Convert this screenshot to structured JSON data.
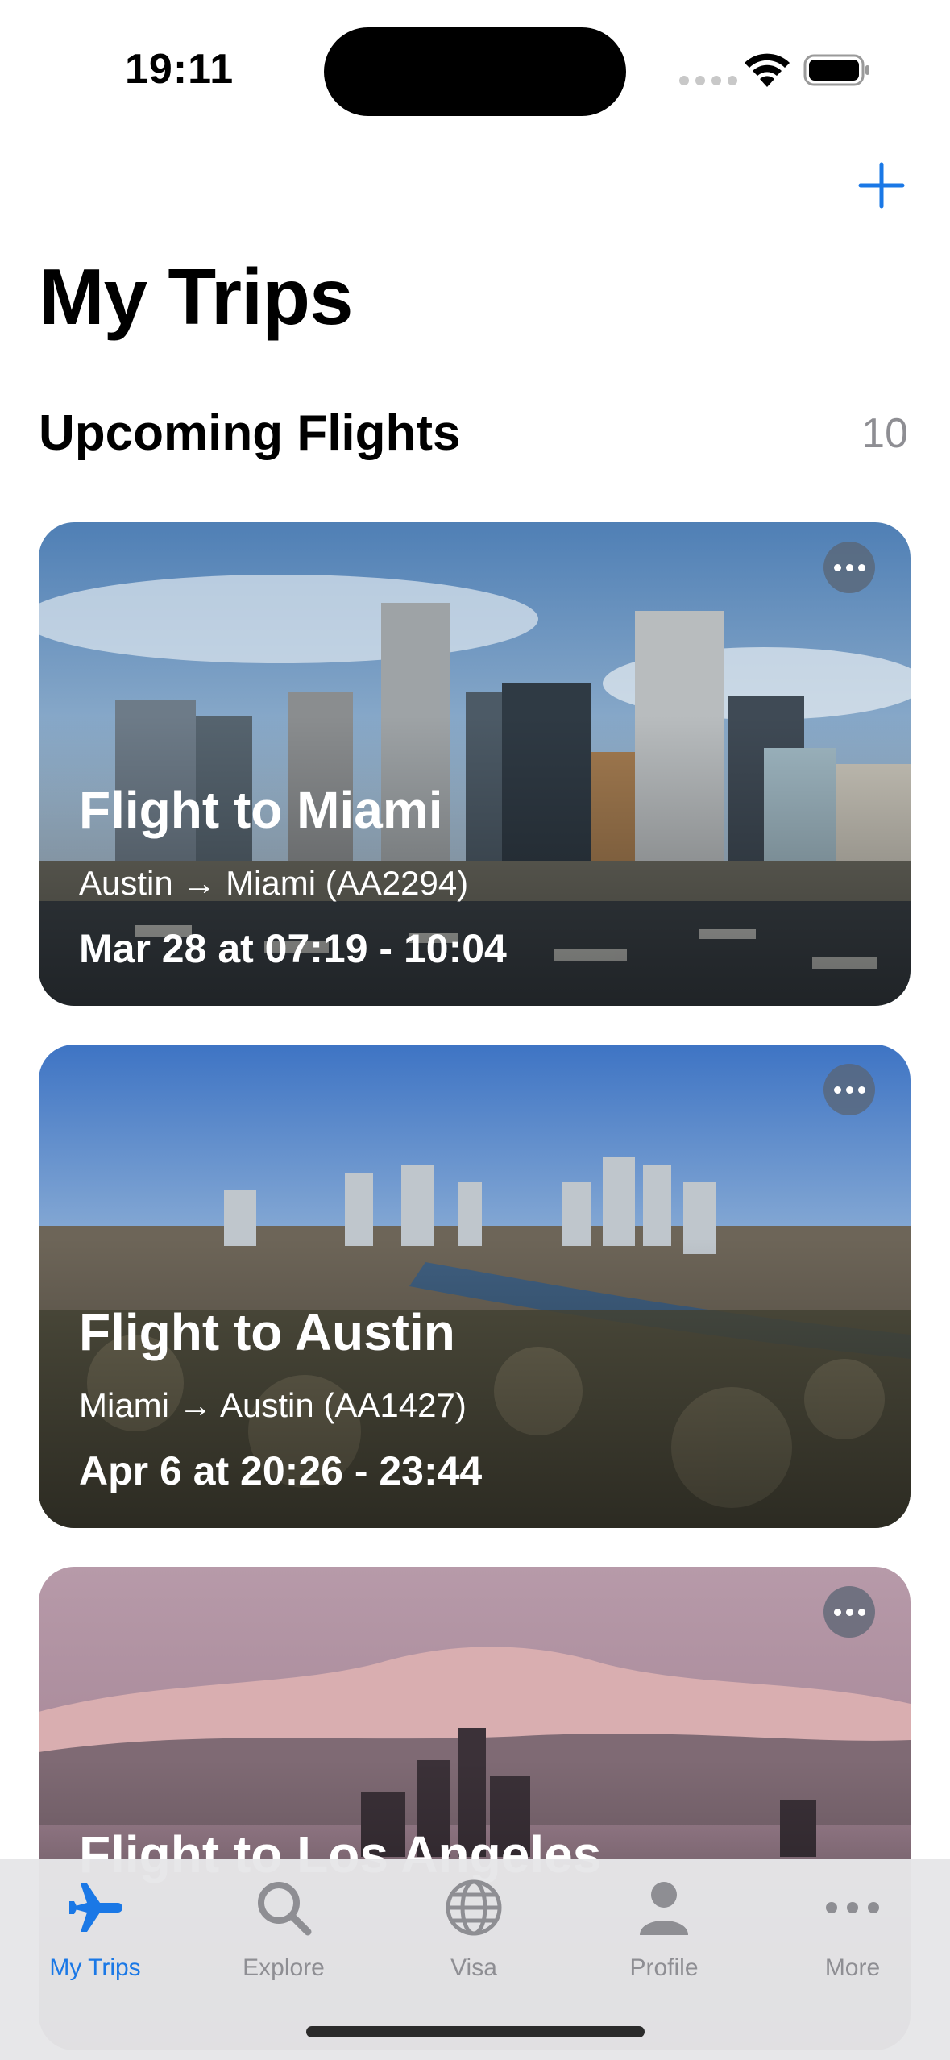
{
  "status_bar": {
    "time": "19:11"
  },
  "header": {
    "title": "My Trips"
  },
  "section": {
    "title": "Upcoming Flights",
    "count": "10"
  },
  "trips": [
    {
      "title": "Flight to Miami",
      "route": "Austin → Miami (AA2294)",
      "time": "Mar 28 at 07:19 - 10:04"
    },
    {
      "title": "Flight to Austin",
      "route": "Miami → Austin (AA1427)",
      "time": "Apr 6 at 20:26 - 23:44"
    },
    {
      "title": "Flight to Los Angeles"
    }
  ],
  "tabs": [
    {
      "label": "My Trips",
      "icon": "airplane-icon",
      "active": true
    },
    {
      "label": "Explore",
      "icon": "search-icon"
    },
    {
      "label": "Visa",
      "icon": "globe-icon"
    },
    {
      "label": "Profile",
      "icon": "person-icon"
    },
    {
      "label": "More",
      "icon": "ellipsis-icon"
    }
  ],
  "colors": {
    "accent": "#1a78e6",
    "secondary_text": "#8e8e93",
    "tab_bar": "#e6e6e8"
  }
}
